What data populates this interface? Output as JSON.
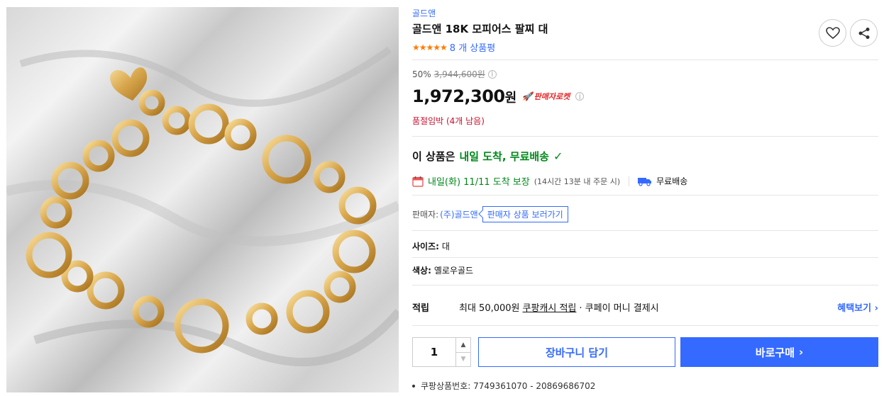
{
  "product": {
    "brand": "골드앤",
    "title": "골드앤 18K 모피어스 팔찌 대",
    "stars": "★★★★★",
    "review_count": "8 개 상품평"
  },
  "pricing": {
    "discount_rate": "50%",
    "original_price": "3,944,600원",
    "price": "1,972,300",
    "price_unit": "원",
    "rocket_label": "판매자로켓",
    "stock_note": "품절임박 (4개 남음)"
  },
  "delivery": {
    "headline_prefix": "이 상품은",
    "headline_highlight": "내일 도착, 무료배송",
    "date_text": "내일(화) 11/11 도착 보장",
    "cutoff_note": "(14시간 13분 내 주문 시)",
    "free_shipping": "무료배송"
  },
  "seller": {
    "label": "판매자:",
    "name": "(주)골드앤",
    "link_label": "판매자 상품 보러가기"
  },
  "options": {
    "size_label": "사이즈:",
    "size_value": "대",
    "color_label": "색상:",
    "color_value": "옐로우골드"
  },
  "cash": {
    "label": "적립",
    "prefix": "최대 50,000원",
    "link": "쿠팡캐시 적립",
    "suffix": "· 쿠페이 머니 결제시",
    "benefit_link": "혜택보기 ›"
  },
  "purchase": {
    "quantity": "1",
    "cart_label": "장바구니 담기",
    "buy_label": "바로구매",
    "buy_arrow": "›"
  },
  "meta": {
    "product_code": "쿠팡상품번호: 7749361070 - 20869686702"
  },
  "colors": {
    "accent": "#346aff",
    "rating": "#ff7b00",
    "delivery_green": "#00891a",
    "alert_red": "#c8102e"
  }
}
